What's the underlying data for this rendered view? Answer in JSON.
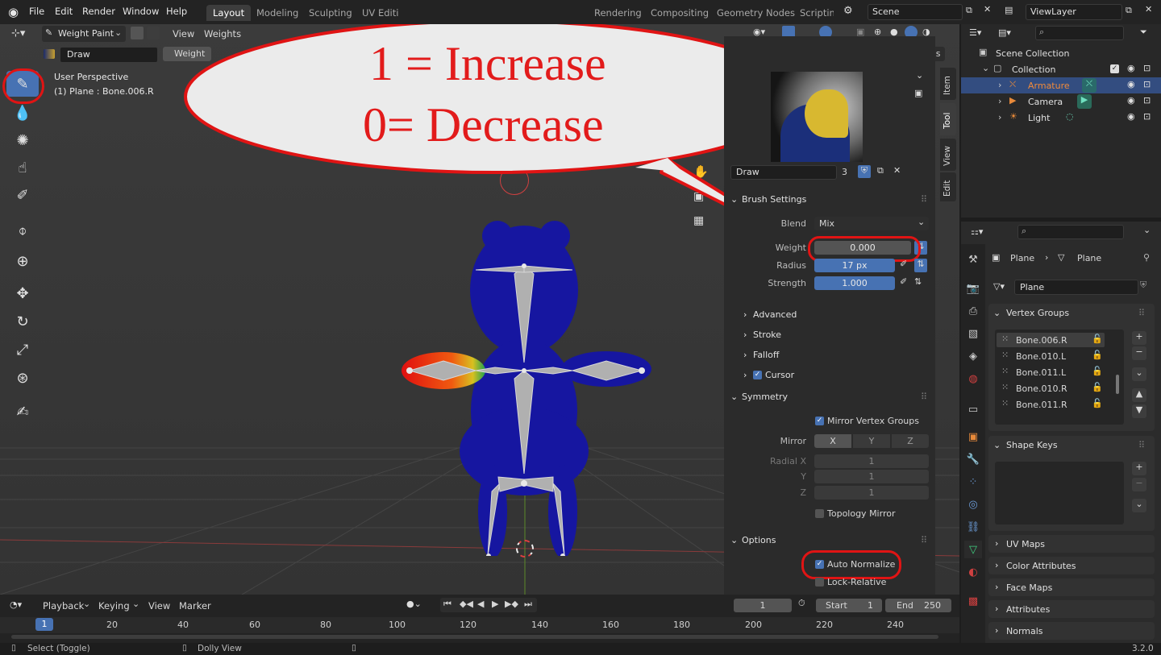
{
  "menu": [
    "File",
    "Edit",
    "Render",
    "Window",
    "Help"
  ],
  "workspaces": [
    "Layout",
    "Modeling",
    "Sculpting",
    "UV Editi",
    "Rendering",
    "Compositing",
    "Geometry Nodes",
    "Scripting"
  ],
  "scene_name": "Scene",
  "view_layer": "ViewLayer",
  "viewport": {
    "mode": "Weight Paint",
    "menus": [
      "View",
      "Weights"
    ],
    "brush_name": "Draw",
    "brush_tab": "Weight",
    "perspective": "User Perspective",
    "object_info": "(1) Plane : Bone.006.R",
    "axes": [
      "X",
      "Y",
      "Z"
    ],
    "options_label": "Options"
  },
  "callout": {
    "line1": "1 = Increase",
    "line2": "0= Decrease"
  },
  "side_tabs": [
    "Item",
    "Tool",
    "View",
    "Edit"
  ],
  "npanel": {
    "brush_name": "Draw",
    "brush_users": "3",
    "brush_settings_label": "Brush Settings",
    "blend_label": "Blend",
    "blend_value": "Mix",
    "weight_label": "Weight",
    "weight_value": "0.000",
    "radius_label": "Radius",
    "radius_value": "17 px",
    "strength_label": "Strength",
    "strength_value": "1.000",
    "subsections": [
      "Advanced",
      "Stroke",
      "Falloff",
      "Cursor"
    ],
    "symmetry_label": "Symmetry",
    "mirror_vg_label": "Mirror Vertex Groups",
    "mirror_label": "Mirror",
    "mirror_axes": [
      "X",
      "Y",
      "Z"
    ],
    "radial_x_label": "Radial X",
    "radial_y_label": "Y",
    "radial_z_label": "Z",
    "radial_values": [
      "1",
      "1",
      "1"
    ],
    "topology_mirror_label": "Topology Mirror",
    "options_label": "Options",
    "auto_normalize_label": "Auto Normalize",
    "lock_relative_label": "Lock-Relative"
  },
  "outliner": {
    "scene_collection": "Scene Collection",
    "collection": "Collection",
    "items": [
      "Armature",
      "Camera",
      "Light"
    ]
  },
  "properties": {
    "breadcrumb_a": "Plane",
    "breadcrumb_b": "Plane",
    "mesh_name": "Plane",
    "vertex_groups_label": "Vertex Groups",
    "vertex_groups": [
      "Bone.006.R",
      "Bone.010.L",
      "Bone.011.L",
      "Bone.010.R",
      "Bone.011.R"
    ],
    "shape_keys_label": "Shape Keys",
    "collapsed": [
      "UV Maps",
      "Color Attributes",
      "Face Maps",
      "Attributes",
      "Normals"
    ]
  },
  "timeline": {
    "menus": [
      "Playback",
      "Keying",
      "View",
      "Marker"
    ],
    "current_frame": "1",
    "start_label": "Start",
    "start_value": "1",
    "end_label": "End",
    "end_value": "250",
    "ticks": [
      "1",
      "20",
      "40",
      "60",
      "80",
      "100",
      "120",
      "140",
      "160",
      "180",
      "200",
      "220",
      "240"
    ]
  },
  "status": {
    "select": "Select (Toggle)",
    "dolly": "Dolly View",
    "version": "3.2.0"
  },
  "colors": {
    "accent": "#4772b3",
    "annotation": "#e01414",
    "mesh": "#1a1a8c"
  }
}
